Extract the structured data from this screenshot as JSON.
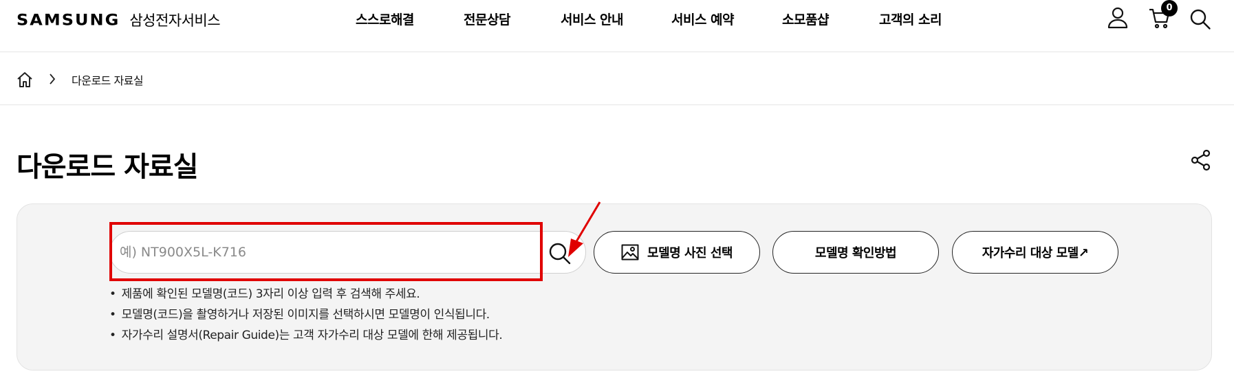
{
  "header": {
    "brand": "SAMSUNG",
    "brand_sub": "삼성전자서비스",
    "nav": [
      "스스로해결",
      "전문상담",
      "서비스 안내",
      "서비스 예약",
      "소모품샵",
      "고객의 소리"
    ],
    "cart_count": "0"
  },
  "breadcrumb": {
    "current": "다운로드 자료실"
  },
  "page": {
    "title": "다운로드 자료실"
  },
  "search": {
    "placeholder": "예) NT900X5L-K716",
    "value": "",
    "photo_button": "모델명 사진 선택",
    "howto_button": "모델명 확인방법",
    "selfrepair_button": "자가수리 대상 모델↗",
    "notes": [
      "제품에 확인된 모델명(코드) 3자리 이상 입력 후 검색해 주세요.",
      "모델명(코드)을 촬영하거나 저장된 이미지를 선택하시면 모델명이 인식됩니다.",
      "자가수리 설명서(Repair Guide)는 고객 자가수리 대상 모델에 한해 제공됩니다."
    ]
  },
  "colors": {
    "highlight": "#e00000",
    "panel_bg": "#f4f4f4"
  },
  "icons": [
    "home-icon",
    "chevron-right-icon",
    "user-icon",
    "cart-icon",
    "search-icon",
    "share-icon",
    "image-icon",
    "arrow-annotation"
  ]
}
